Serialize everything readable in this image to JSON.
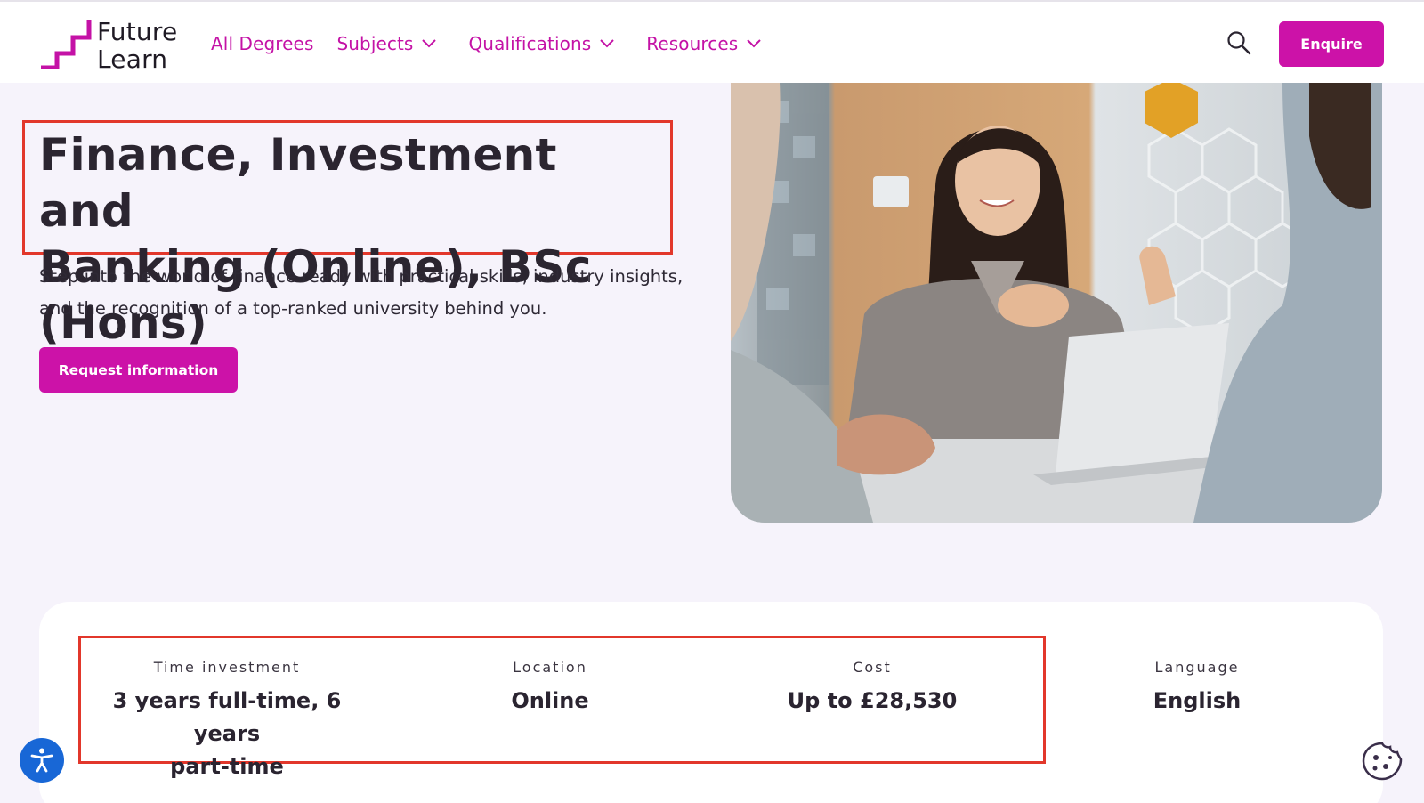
{
  "brand": {
    "logo_line1": "Future",
    "logo_line2": "Learn",
    "accent": "#cc12a8"
  },
  "nav": {
    "items": [
      {
        "label": "All Degrees",
        "has_dropdown": false
      },
      {
        "label": "Subjects",
        "has_dropdown": true
      },
      {
        "label": "Qualifications",
        "has_dropdown": true
      },
      {
        "label": "Resources",
        "has_dropdown": true
      }
    ],
    "search_icon": "search-icon",
    "enquire_label": "Enquire"
  },
  "hero": {
    "title_line1": "Finance, Investment and",
    "title_line2": "Banking (Online), BSc (Hons)",
    "subtitle_line1": "Step into the world of finance ready with practical skills, industry insights,",
    "subtitle_line2": "and the recognition of a top-ranked university behind you.",
    "cta_label": "Request information",
    "image": "photo-woman-presenting-at-laptop"
  },
  "info": {
    "items": [
      {
        "label": "Time investment",
        "value_line1": "3 years full-time, 6 years",
        "value_line2": "part-time"
      },
      {
        "label": "Location",
        "value_line1": "Online"
      },
      {
        "label": "Cost",
        "value_line1": "Up to £28,530"
      },
      {
        "label": "Language",
        "value_line1": "English"
      }
    ]
  },
  "floating": {
    "accessibility_icon": "accessibility-icon",
    "cookie_icon": "cookie-icon"
  },
  "annotation_color": "#e2372b"
}
